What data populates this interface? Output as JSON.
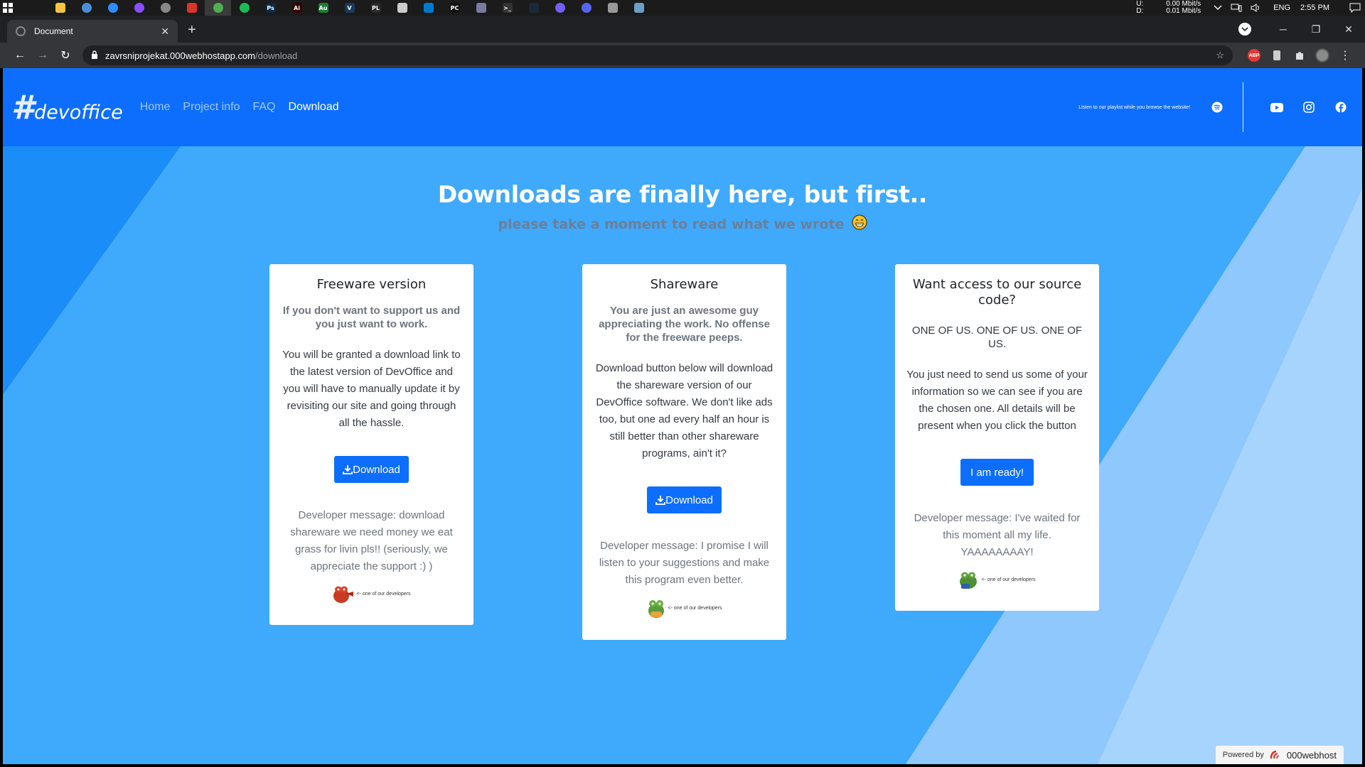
{
  "taskbar": {
    "apps": [
      {
        "name": "file-explorer",
        "color": "#f4c542",
        "glyph": ""
      },
      {
        "name": "app-blue-circle",
        "color": "#4a90d9",
        "glyph": ""
      },
      {
        "name": "zoom",
        "color": "#2d8cff",
        "glyph": ""
      },
      {
        "name": "messenger",
        "color": "#8a4dff",
        "glyph": ""
      },
      {
        "name": "app-gray",
        "color": "#888888",
        "glyph": ""
      },
      {
        "name": "app-red",
        "color": "#d9342b",
        "glyph": ""
      },
      {
        "name": "chrome",
        "color": "#4caf50",
        "glyph": ""
      },
      {
        "name": "spotify",
        "color": "#1db954",
        "glyph": ""
      },
      {
        "name": "photoshop",
        "color": "#0b2a4a",
        "glyph": "Ps"
      },
      {
        "name": "illustrator",
        "color": "#330000",
        "glyph": "Ai"
      },
      {
        "name": "app-green",
        "color": "#1e7e34",
        "glyph": "Au"
      },
      {
        "name": "app-v",
        "color": "#1b3a5c",
        "glyph": "V"
      },
      {
        "name": "app-plj",
        "color": "#2a2a2a",
        "glyph": "PL"
      },
      {
        "name": "app-cursor",
        "color": "#cccccc",
        "glyph": ""
      },
      {
        "name": "vscode",
        "color": "#007acc",
        "glyph": ""
      },
      {
        "name": "pycharm",
        "color": "#111111",
        "glyph": "PC"
      },
      {
        "name": "app-bar",
        "color": "#7a7aa0",
        "glyph": ""
      },
      {
        "name": "terminal",
        "color": "#333333",
        "glyph": ">_"
      },
      {
        "name": "steam",
        "color": "#1b2838",
        "glyph": ""
      },
      {
        "name": "viber",
        "color": "#7360f2",
        "glyph": ""
      },
      {
        "name": "discord",
        "color": "#5865f2",
        "glyph": ""
      },
      {
        "name": "app-game",
        "color": "#999999",
        "glyph": ""
      },
      {
        "name": "app-image",
        "color": "#6aa0c8",
        "glyph": ""
      }
    ],
    "net_labels": [
      "U:",
      "D:"
    ],
    "net_values": [
      "0.00 Mbit/s",
      "0.01 Mbit/s"
    ],
    "lang": "ENG",
    "time": "2:55 PM"
  },
  "browser": {
    "tab_title": "Document",
    "url_host": "zavrsniprojekat.000webhostapp.com",
    "url_path": "/download"
  },
  "site": {
    "brand_hash": "#",
    "brand_word": "devoffice",
    "nav": [
      "Home",
      "Project info",
      "FAQ",
      "Download"
    ],
    "playlist_text": "Listen to our playlist while you browse the website!",
    "hero_title": "Downloads are finally here, but first..",
    "hero_sub": "please take a moment to read what we wrote",
    "cards": [
      {
        "title": "Freeware version",
        "lead": "If you don't want to support us and you just want to work.",
        "body": "You will be granted a download link to the latest version of DevOffice and you will have to manually update it by revisiting our site and going through all the hassle.",
        "button": "Download",
        "dev": "Developer message: download shareware we need money we eat grass for livin pls!! (seriously, we appreciate the support :) )",
        "caption": "<- one of our developers"
      },
      {
        "title": "Shareware",
        "lead": "You are just an awesome guy appreciating the work. No offense for the freeware peeps.",
        "body": "Download button below will download the shareware version of our DevOffice software. We don't like ads too, but one ad every half an hour is still better than other shareware programs, ain't it?",
        "button": "Download",
        "dev": "Developer message: I promise I will listen to your suggestions and make this program even better.",
        "caption": "<- one of our developers"
      },
      {
        "title": "Want access to our source code?",
        "lead": "ONE OF US. ONE OF US. ONE OF US.",
        "body": "You just need to send us some of your information so we can see if you are the chosen one. All details will be present when you click the button",
        "button": "I am ready!",
        "dev": "Developer message: I've waited for this moment all my life. YAAAAAAAAY!",
        "caption": "<- one of our developers"
      }
    ],
    "powered_by": "Powered by",
    "host_brand": "000webhost"
  },
  "colors": {
    "navbar": "#0d6efd",
    "page_bg": "#3fa9fb",
    "button": "#0d6efd"
  }
}
